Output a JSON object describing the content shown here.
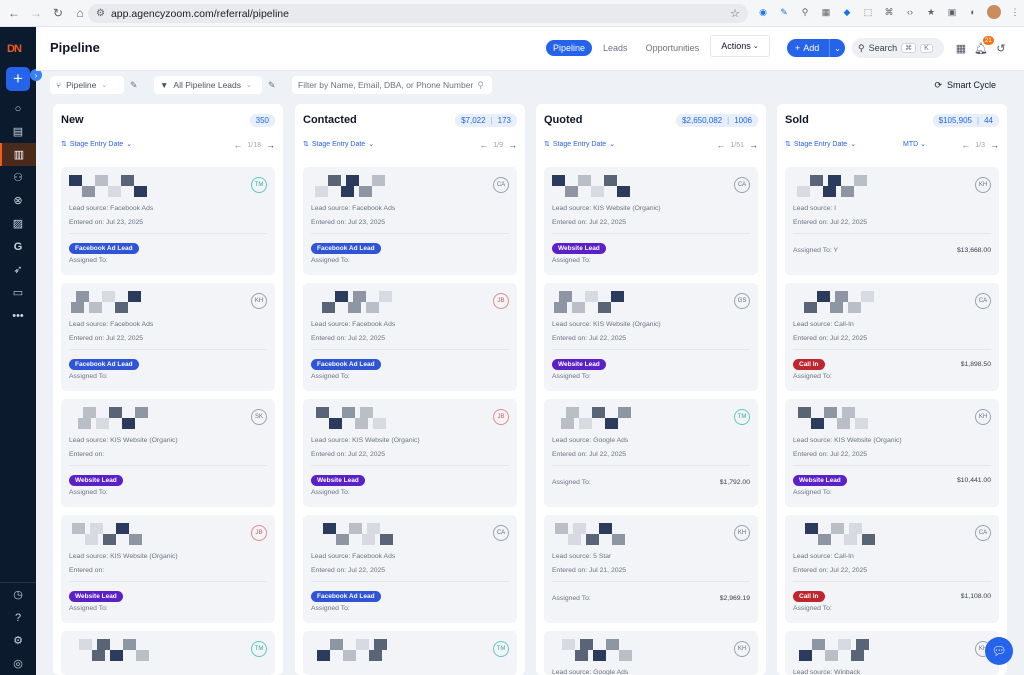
{
  "browser": {
    "url": "app.agencyzoom.com/referral/pipeline"
  },
  "header": {
    "title": "Pipeline",
    "tabs": [
      {
        "label": "Pipeline",
        "active": true
      },
      {
        "label": "Leads",
        "active": false
      },
      {
        "label": "Opportunities",
        "active": false
      }
    ],
    "actions_label": "Actions",
    "add_label": "Add",
    "search_label": "Search",
    "search_shortcut": [
      "⌘",
      "K"
    ],
    "notification_count": "21"
  },
  "filters": {
    "pipeline_label": "Pipeline",
    "leads_filter_label": "All Pipeline Leads",
    "search_placeholder": "Filter by Name, Email, DBA, or Phone Number",
    "smart_cycle_label": "Smart Cycle"
  },
  "columns": [
    {
      "name": "New",
      "amount": "",
      "count": "350",
      "sort_label": "Stage Entry Date",
      "period": "",
      "pager": "1/18",
      "cards": [
        {
          "initials": "TM",
          "avatar_color": "teal",
          "lead_source": "Lead source: Facebook Ads",
          "entered": "Entered on: Jul 23, 2025",
          "tag": "Facebook Ad Lead",
          "tag_type": "fb",
          "assigned": "Assigned To:",
          "amount": ""
        },
        {
          "initials": "KH",
          "avatar_color": "gray",
          "lead_source": "Lead source: Facebook Ads",
          "entered": "Entered on: Jul 22, 2025",
          "tag": "Facebook Ad Lead",
          "tag_type": "fb",
          "assigned": "Assigned To:",
          "amount": ""
        },
        {
          "initials": "SK",
          "avatar_color": "gray",
          "lead_source": "Lead source: KIS Website (Organic)",
          "entered": "Entered on:",
          "tag": "Website Lead",
          "tag_type": "web",
          "assigned": "Assigned To:",
          "amount": ""
        },
        {
          "initials": "JB",
          "avatar_color": "red",
          "lead_source": "Lead source: KIS Website (Organic)",
          "entered": "Entered on:",
          "tag": "Website Lead",
          "tag_type": "web",
          "assigned": "Assigned To:",
          "amount": ""
        },
        {
          "initials": "TM",
          "avatar_color": "teal",
          "lead_source": "",
          "entered": "",
          "tag": "",
          "tag_type": "",
          "assigned": "",
          "amount": ""
        }
      ]
    },
    {
      "name": "Contacted",
      "amount": "$7,022",
      "count": "173",
      "sort_label": "Stage Entry Date",
      "period": "",
      "pager": "1/9",
      "cards": [
        {
          "initials": "CA",
          "avatar_color": "gray",
          "lead_source": "Lead source: Facebook Ads",
          "entered": "Entered on: Jul 23, 2025",
          "tag": "Facebook Ad Lead",
          "tag_type": "fb",
          "assigned": "Assigned To:",
          "amount": ""
        },
        {
          "initials": "JB",
          "avatar_color": "red",
          "lead_source": "Lead source: Facebook Ads",
          "entered": "Entered on: Jul 22, 2025",
          "tag": "Facebook Ad Lead",
          "tag_type": "fb",
          "assigned": "Assigned To:",
          "amount": ""
        },
        {
          "initials": "JB",
          "avatar_color": "red",
          "lead_source": "Lead source: KIS Website (Organic)",
          "entered": "Entered on: Jul 22, 2025",
          "tag": "Website Lead",
          "tag_type": "web",
          "assigned": "Assigned To:",
          "amount": ""
        },
        {
          "initials": "CA",
          "avatar_color": "gray",
          "lead_source": "Lead source: Facebook Ads",
          "entered": "Entered on: Jul 22, 2025",
          "tag": "Facebook Ad Lead",
          "tag_type": "fb",
          "assigned": "Assigned To:",
          "amount": ""
        },
        {
          "initials": "TM",
          "avatar_color": "teal",
          "lead_source": "",
          "entered": "",
          "tag": "",
          "tag_type": "",
          "assigned": "",
          "amount": ""
        }
      ]
    },
    {
      "name": "Quoted",
      "amount": "$2,650,082",
      "count": "1006",
      "sort_label": "Stage Entry Date",
      "period": "",
      "pager": "1/51",
      "cards": [
        {
          "initials": "CA",
          "avatar_color": "gray",
          "lead_source": "Lead source: KIS Website (Organic)",
          "entered": "Entered on: Jul 22, 2025",
          "tag": "Website Lead",
          "tag_type": "web",
          "assigned": "Assigned To:",
          "amount": ""
        },
        {
          "initials": "GS",
          "avatar_color": "gray",
          "lead_source": "Lead source: KIS Website (Organic)",
          "entered": "Entered on: Jul 22, 2025",
          "tag": "Website Lead",
          "tag_type": "web",
          "assigned": "Assigned To:",
          "amount": ""
        },
        {
          "initials": "TM",
          "avatar_color": "teal",
          "lead_source": "Lead source: Google Ads",
          "entered": "Entered on: Jul 22, 2025",
          "tag": "",
          "tag_type": "",
          "assigned": "Assigned To:",
          "amount": "$1,792.00"
        },
        {
          "initials": "KH",
          "avatar_color": "gray",
          "lead_source": "Lead source: 5 Star",
          "entered": "Entered on: Jul 21, 2025",
          "tag": "",
          "tag_type": "",
          "assigned": "Assigned To:",
          "amount": "$2,969.19"
        },
        {
          "initials": "KH",
          "avatar_color": "gray",
          "lead_source": "Lead source: Google Ads",
          "entered": "Entered on: Jul 21, 2025",
          "tag": "",
          "tag_type": "",
          "assigned": "",
          "amount": ""
        }
      ]
    },
    {
      "name": "Sold",
      "amount": "$105,905",
      "count": "44",
      "sort_label": "Stage Entry Date",
      "period": "MTD",
      "pager": "1/3",
      "cards": [
        {
          "initials": "KH",
          "avatar_color": "gray",
          "lead_source": "Lead source: I",
          "entered": "Entered on: Jul 22, 2025",
          "tag": "",
          "tag_type": "",
          "assigned": "Assigned To: Y",
          "amount": "$13,668.00"
        },
        {
          "initials": "CA",
          "avatar_color": "gray",
          "lead_source": "Lead source: Call-In",
          "entered": "Entered on: Jul 22, 2025",
          "tag": "Call In",
          "tag_type": "call",
          "assigned": "Assigned To:",
          "amount": "$1,898.50"
        },
        {
          "initials": "KH",
          "avatar_color": "gray",
          "lead_source": "Lead source: KIS Website (Organic)",
          "entered": "Entered on: Jul 22, 2025",
          "tag": "Website Lead",
          "tag_type": "web",
          "assigned": "Assigned To:",
          "amount": "$10,441.00"
        },
        {
          "initials": "CA",
          "avatar_color": "gray",
          "lead_source": "Lead source: Call-In",
          "entered": "Entered on: Jul 22, 2025",
          "tag": "Call In",
          "tag_type": "call",
          "assigned": "Assigned To:",
          "amount": "$1,108.00"
        },
        {
          "initials": "KH",
          "avatar_color": "gray",
          "lead_source": "Lead source: Winback",
          "entered": "",
          "tag": "",
          "tag_type": "",
          "assigned": "",
          "amount": ""
        }
      ]
    }
  ]
}
